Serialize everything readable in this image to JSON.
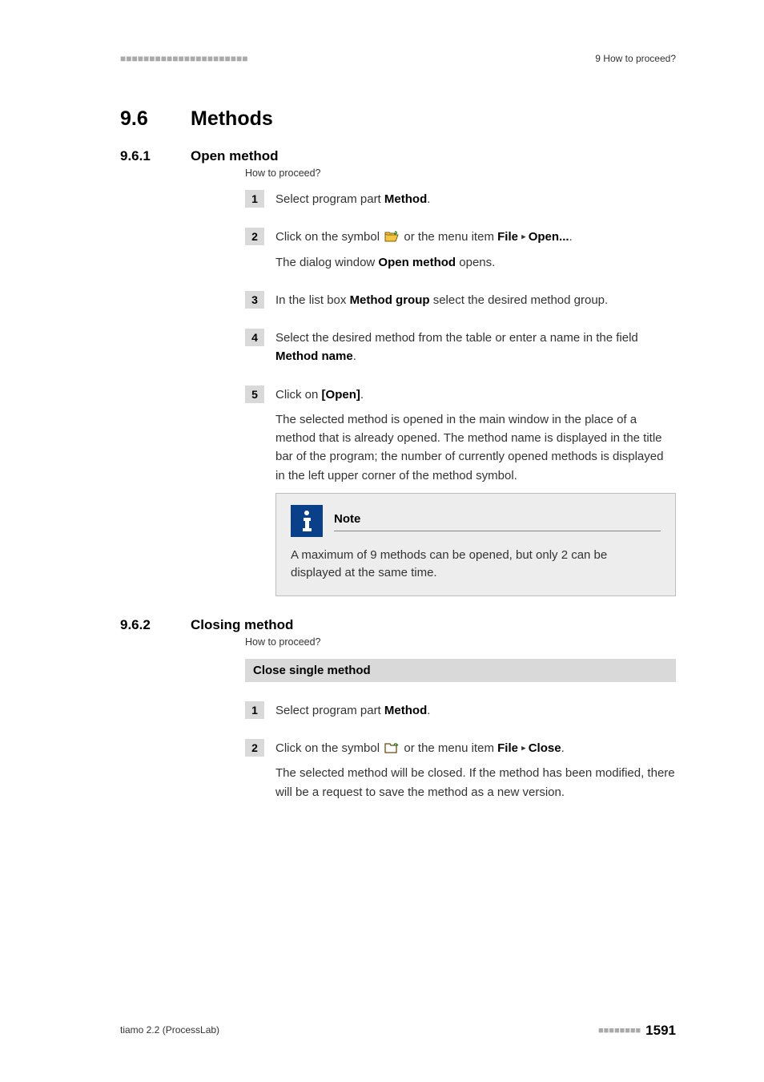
{
  "header": {
    "section_label": "9 How to proceed?"
  },
  "section": {
    "number": "9.6",
    "title": "Methods"
  },
  "sub1": {
    "number": "9.6.1",
    "title": "Open method",
    "hint": "How to proceed?",
    "steps": {
      "s1": {
        "num": "1",
        "lead": "Select program part ",
        "bold": "Method",
        "tail": "."
      },
      "s2": {
        "num": "2",
        "p1a": "Click on the symbol ",
        "p1b": " or the menu item ",
        "menu1": "File",
        "menu2": "Open...",
        "p1c": ".",
        "p2a": "The dialog window ",
        "dlg": "Open method",
        "p2b": " opens."
      },
      "s3": {
        "num": "3",
        "a": "In the list box ",
        "b": "Method group",
        "c": " select the desired method group."
      },
      "s4": {
        "num": "4",
        "a": "Select the desired method from the table or enter a name in the field ",
        "b": "Method name",
        "c": "."
      },
      "s5": {
        "num": "5",
        "a": "Click on ",
        "b": "[Open]",
        "c": ".",
        "para": "The selected method is opened in the main window in the place of a method that is already opened. The method name is displayed in the title bar of the program; the number of currently opened methods is displayed in the left upper corner of the method symbol.",
        "note_label": "Note",
        "note_text": "A maximum of 9 methods can be opened, but only 2 can be displayed at the same time."
      }
    }
  },
  "sub2": {
    "number": "9.6.2",
    "title": "Closing method",
    "hint": "How to proceed?",
    "proc_header": "Close single method",
    "steps": {
      "s1": {
        "num": "1",
        "lead": "Select program part ",
        "bold": "Method",
        "tail": "."
      },
      "s2": {
        "num": "2",
        "p1a": "Click on the symbol ",
        "p1b": " or the menu item ",
        "menu1": "File",
        "menu2": "Close",
        "p1c": ".",
        "p2": "The selected method will be closed. If the method has been modified, there will be a request to save the method as a new version."
      }
    }
  },
  "footer": {
    "left": "tiamo 2.2 (ProcessLab)",
    "page": "1591"
  }
}
